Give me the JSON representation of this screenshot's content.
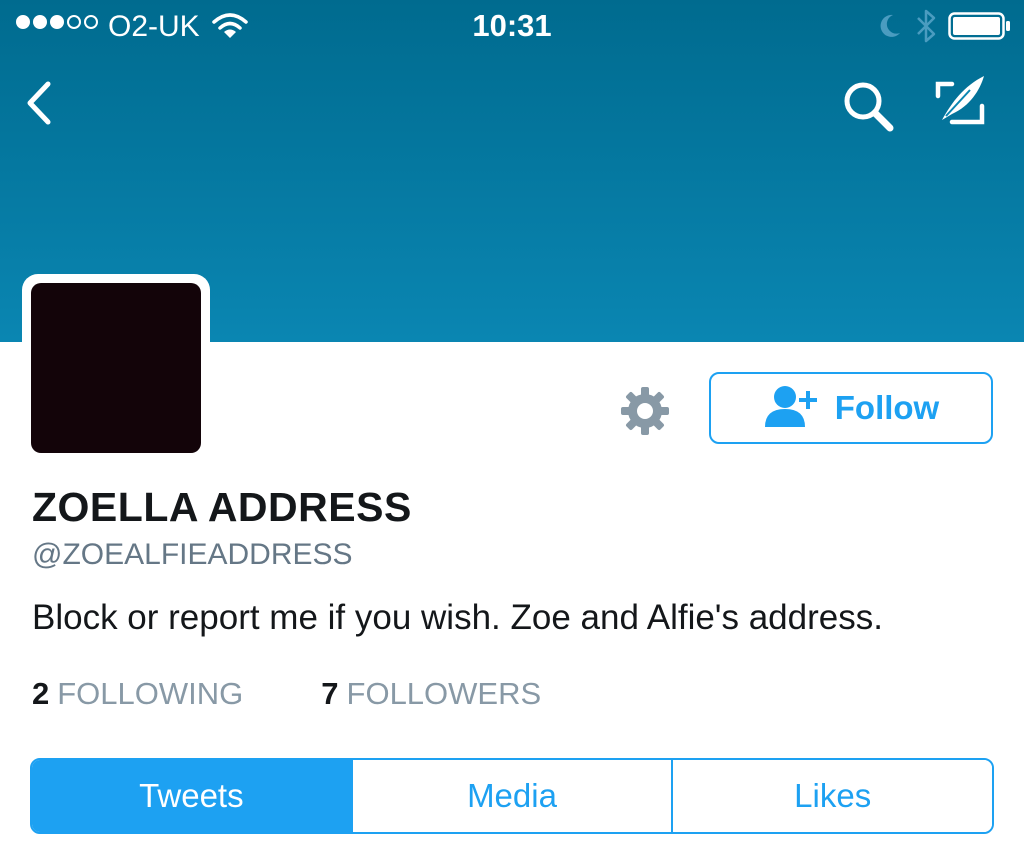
{
  "status_bar": {
    "signal_dots_filled": 3,
    "signal_dots_total": 5,
    "carrier": "O2-UK",
    "time": "10:31",
    "icons": [
      "wifi-icon",
      "moon-icon",
      "bluetooth-icon",
      "battery-icon"
    ]
  },
  "nav": {
    "icons": [
      "back-chevron-icon",
      "search-icon",
      "compose-tweet-icon"
    ]
  },
  "profile": {
    "name": "ZOELLA ADDRESS",
    "handle": "@ZOEALFIEADDRESS",
    "bio": "Block or report me if you wish. Zoe and Alfie's address.",
    "following_count": "2",
    "following_label": "FOLLOWING",
    "followers_count": "7",
    "followers_label": "FOLLOWERS"
  },
  "actions": {
    "follow_label": "Follow",
    "icons": [
      "gear-icon",
      "add-user-icon"
    ]
  },
  "tabs": [
    {
      "label": "Tweets",
      "active": true
    },
    {
      "label": "Media",
      "active": false
    },
    {
      "label": "Likes",
      "active": false
    }
  ],
  "colors": {
    "accent": "#1da1f2",
    "header_top": "#006b8f",
    "header_bottom": "#0a86b2",
    "avatar": "#130409",
    "muted_text": "#657786"
  }
}
